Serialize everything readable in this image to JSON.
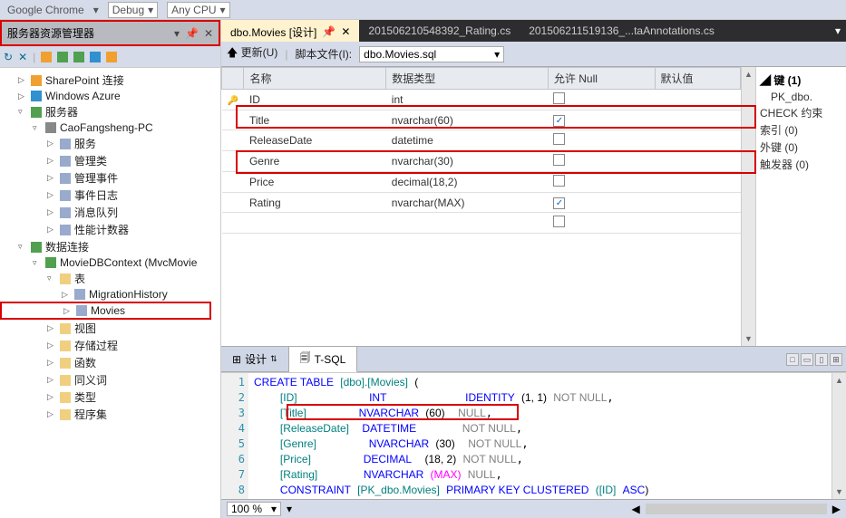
{
  "topbar": {
    "browser": "Google Chrome",
    "config": "Debug",
    "cpu": "Any CPU"
  },
  "leftPane": {
    "title": "服务器资源管理器",
    "nodes": {
      "sharepoint": "SharePoint 连接",
      "azure": "Windows Azure",
      "server": "服务器",
      "pc": "CaoFangsheng-PC",
      "services": "服务",
      "mgmt": "管理类",
      "events": "管理事件",
      "eventlog": "事件日志",
      "msgqueue": "消息队列",
      "perf": "性能计数器",
      "dataconn": "数据连接",
      "dbcontext": "MovieDBContext (MvcMovie",
      "tables": "表",
      "migration": "MigrationHistory",
      "movies": "Movies",
      "views": "视图",
      "sprocs": "存储过程",
      "funcs": "函数",
      "synonyms": "同义词",
      "types": "类型",
      "assemblies": "程序集"
    }
  },
  "tabs": {
    "t1": "dbo.Movies [设计]",
    "t2": "201506210548392_Rating.cs",
    "t3": "201506211519136_...taAnnotations.cs"
  },
  "subtoolbar": {
    "update": "更新(U)",
    "scriptfile": "脚本文件(I):",
    "filename": "dbo.Movies.sql"
  },
  "grid": {
    "h_name": "名称",
    "h_type": "数据类型",
    "h_null": "允许 Null",
    "h_default": "默认值",
    "rows": [
      {
        "key": true,
        "name": "ID",
        "type": "int",
        "null": false
      },
      {
        "key": false,
        "name": "Title",
        "type": "nvarchar(60)",
        "null": true,
        "red": true
      },
      {
        "key": false,
        "name": "ReleaseDate",
        "type": "datetime",
        "null": false
      },
      {
        "key": false,
        "name": "Genre",
        "type": "nvarchar(30)",
        "null": false,
        "red": true
      },
      {
        "key": false,
        "name": "Price",
        "type": "decimal(18,2)",
        "null": false
      },
      {
        "key": false,
        "name": "Rating",
        "type": "nvarchar(MAX)",
        "null": true
      }
    ]
  },
  "props": {
    "keys": "键 (1)",
    "pk": "PK_dbo.",
    "check": "CHECK 约束",
    "index": "索引 (0)",
    "fk": "外键 (0)",
    "trigger": "触发器 (0)"
  },
  "bottomTabs": {
    "design": "设计",
    "tsql": "T-SQL"
  },
  "sql": {
    "l1_a": "CREATE TABLE",
    "l1_b": "[dbo].[Movies]",
    "l2_a": "[ID]",
    "l2_b": "INT",
    "l2_c": "IDENTITY",
    "l2_d": "(1, 1)",
    "l2_e": "NOT NULL",
    "l3_a": "[Title]",
    "l3_b": "NVARCHAR",
    "l3_c": "(60)",
    "l3_d": "NULL",
    "l4_a": "[ReleaseDate]",
    "l4_b": "DATETIME",
    "l4_e": "NOT NULL",
    "l5_a": "[Genre]",
    "l5_b": "NVARCHAR",
    "l5_c": "(30)",
    "l5_e": "NOT NULL",
    "l6_a": "[Price]",
    "l6_b": "DECIMAL",
    "l6_c": "(18, 2)",
    "l6_e": "NOT NULL",
    "l7_a": "[Rating]",
    "l7_b": "NVARCHAR",
    "l7_c": "(MAX)",
    "l7_d": "NULL",
    "l8_a": "CONSTRAINT",
    "l8_b": "[PK_dbo.Movies]",
    "l8_c": "PRIMARY KEY CLUSTERED",
    "l8_d": "([ID]",
    "l8_e": "ASC"
  },
  "status": {
    "zoom": "100 %"
  }
}
